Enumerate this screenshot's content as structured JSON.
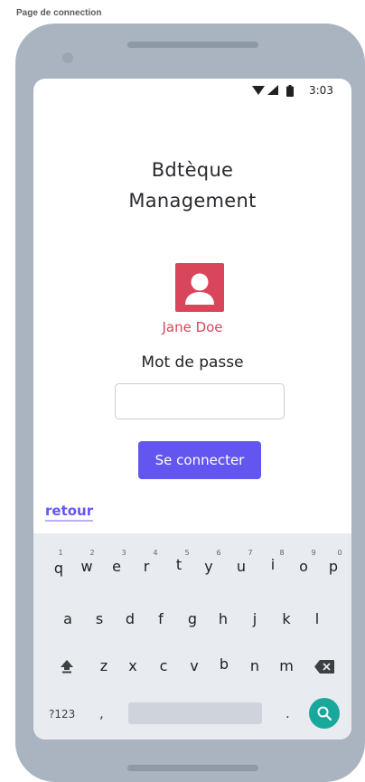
{
  "frame_label": "Page de connection",
  "status_bar": {
    "time": "3:03",
    "icons": [
      "wifi-icon",
      "cellular-signal-icon",
      "battery-icon"
    ]
  },
  "app": {
    "title_line1": "Bdtèque",
    "title_line2": "Management",
    "user_name": "Jane Doe",
    "password_label": "Mot de passe",
    "password_value": "",
    "connect_label": "Se connecter",
    "back_link": "retour"
  },
  "colors": {
    "accent": "#6356f0",
    "avatar": "#d9455b",
    "device": "#a9b4c0",
    "keyboard_bg": "#e8ebf0",
    "search_key": "#1aa89c"
  },
  "keyboard": {
    "row1": [
      "q",
      "w",
      "e",
      "r",
      "t",
      "y",
      "u",
      "i",
      "o",
      "p"
    ],
    "row1_numbers": [
      "1",
      "2",
      "3",
      "4",
      "5",
      "6",
      "7",
      "8",
      "9",
      "0"
    ],
    "row2": [
      "a",
      "s",
      "d",
      "f",
      "g",
      "h",
      "j",
      "k",
      "l"
    ],
    "row3": [
      "z",
      "x",
      "c",
      "v",
      "b",
      "n",
      "m"
    ],
    "symbols_key": "?123",
    "comma_key": ",",
    "period_key": ".",
    "icons": [
      "shift-icon",
      "backspace-icon",
      "search-icon"
    ]
  }
}
